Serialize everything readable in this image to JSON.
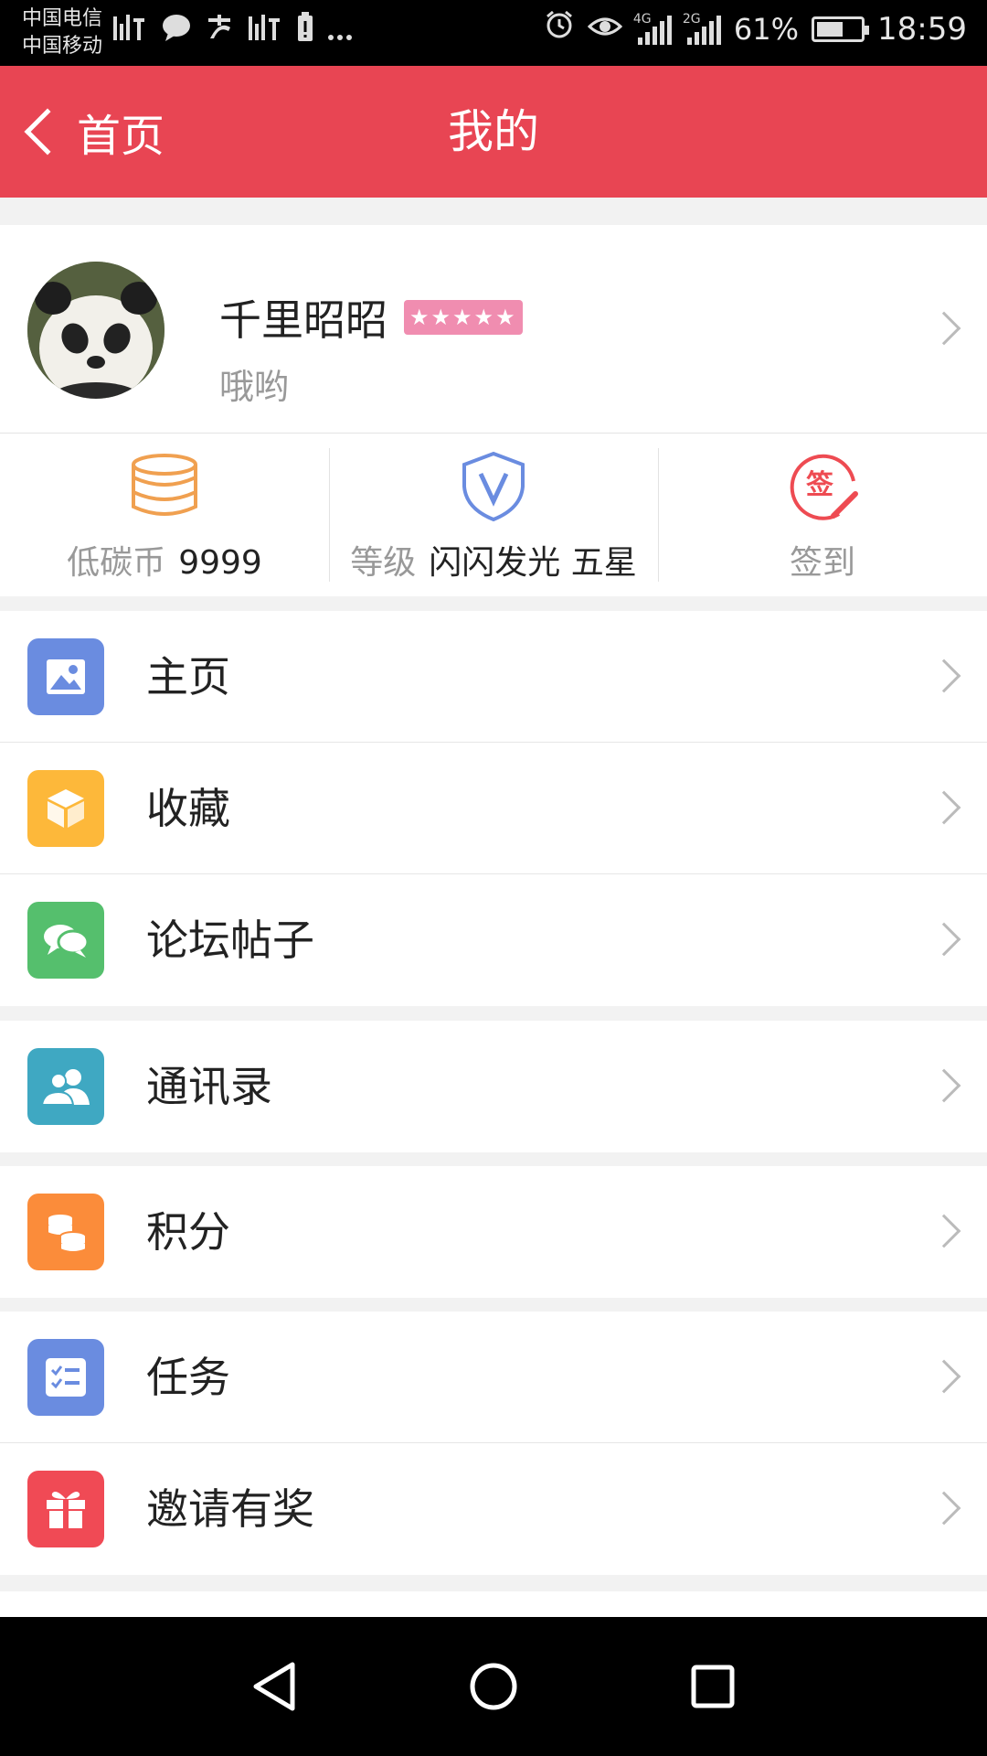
{
  "status_bar": {
    "carrier_1": "中国电信",
    "carrier_2": "中国移动",
    "left_icons": [
      "listen-app-icon",
      "chat-bubble-icon",
      "alipay-icon",
      "listen-app-icon",
      "battery-alert-icon",
      "more-dots-icon"
    ],
    "network_1": "4G",
    "network_2": "2G",
    "battery_percent": "61%",
    "battery_level": 0.61,
    "time": "18:59"
  },
  "nav": {
    "back_label": "首页",
    "title": "我的"
  },
  "profile": {
    "username": "千里昭昭",
    "star_rating": 5,
    "stars_text": "★★★★★",
    "motto": "哦哟"
  },
  "stats": {
    "coins_label": "低碳币",
    "coins_value": "9999",
    "level_label": "等级",
    "level_value": "闪闪发光 五星",
    "checkin_label": "签到",
    "checkin_icon_text": "签"
  },
  "menu": {
    "homepage": "主页",
    "favorites": "收藏",
    "forum_posts": "论坛帖子",
    "contacts": "通讯录",
    "points": "积分",
    "tasks": "任务",
    "invite": "邀请有奖"
  },
  "colors": {
    "accent_red": "#e84553",
    "icon_blue": "#6a8ce0",
    "icon_yellow": "#fdb83a",
    "icon_green": "#55bf6d",
    "icon_teal": "#3fa8c2",
    "icon_orange": "#fb8c3a",
    "icon_red": "#f04a55",
    "coins_icon": "#f0a050"
  }
}
